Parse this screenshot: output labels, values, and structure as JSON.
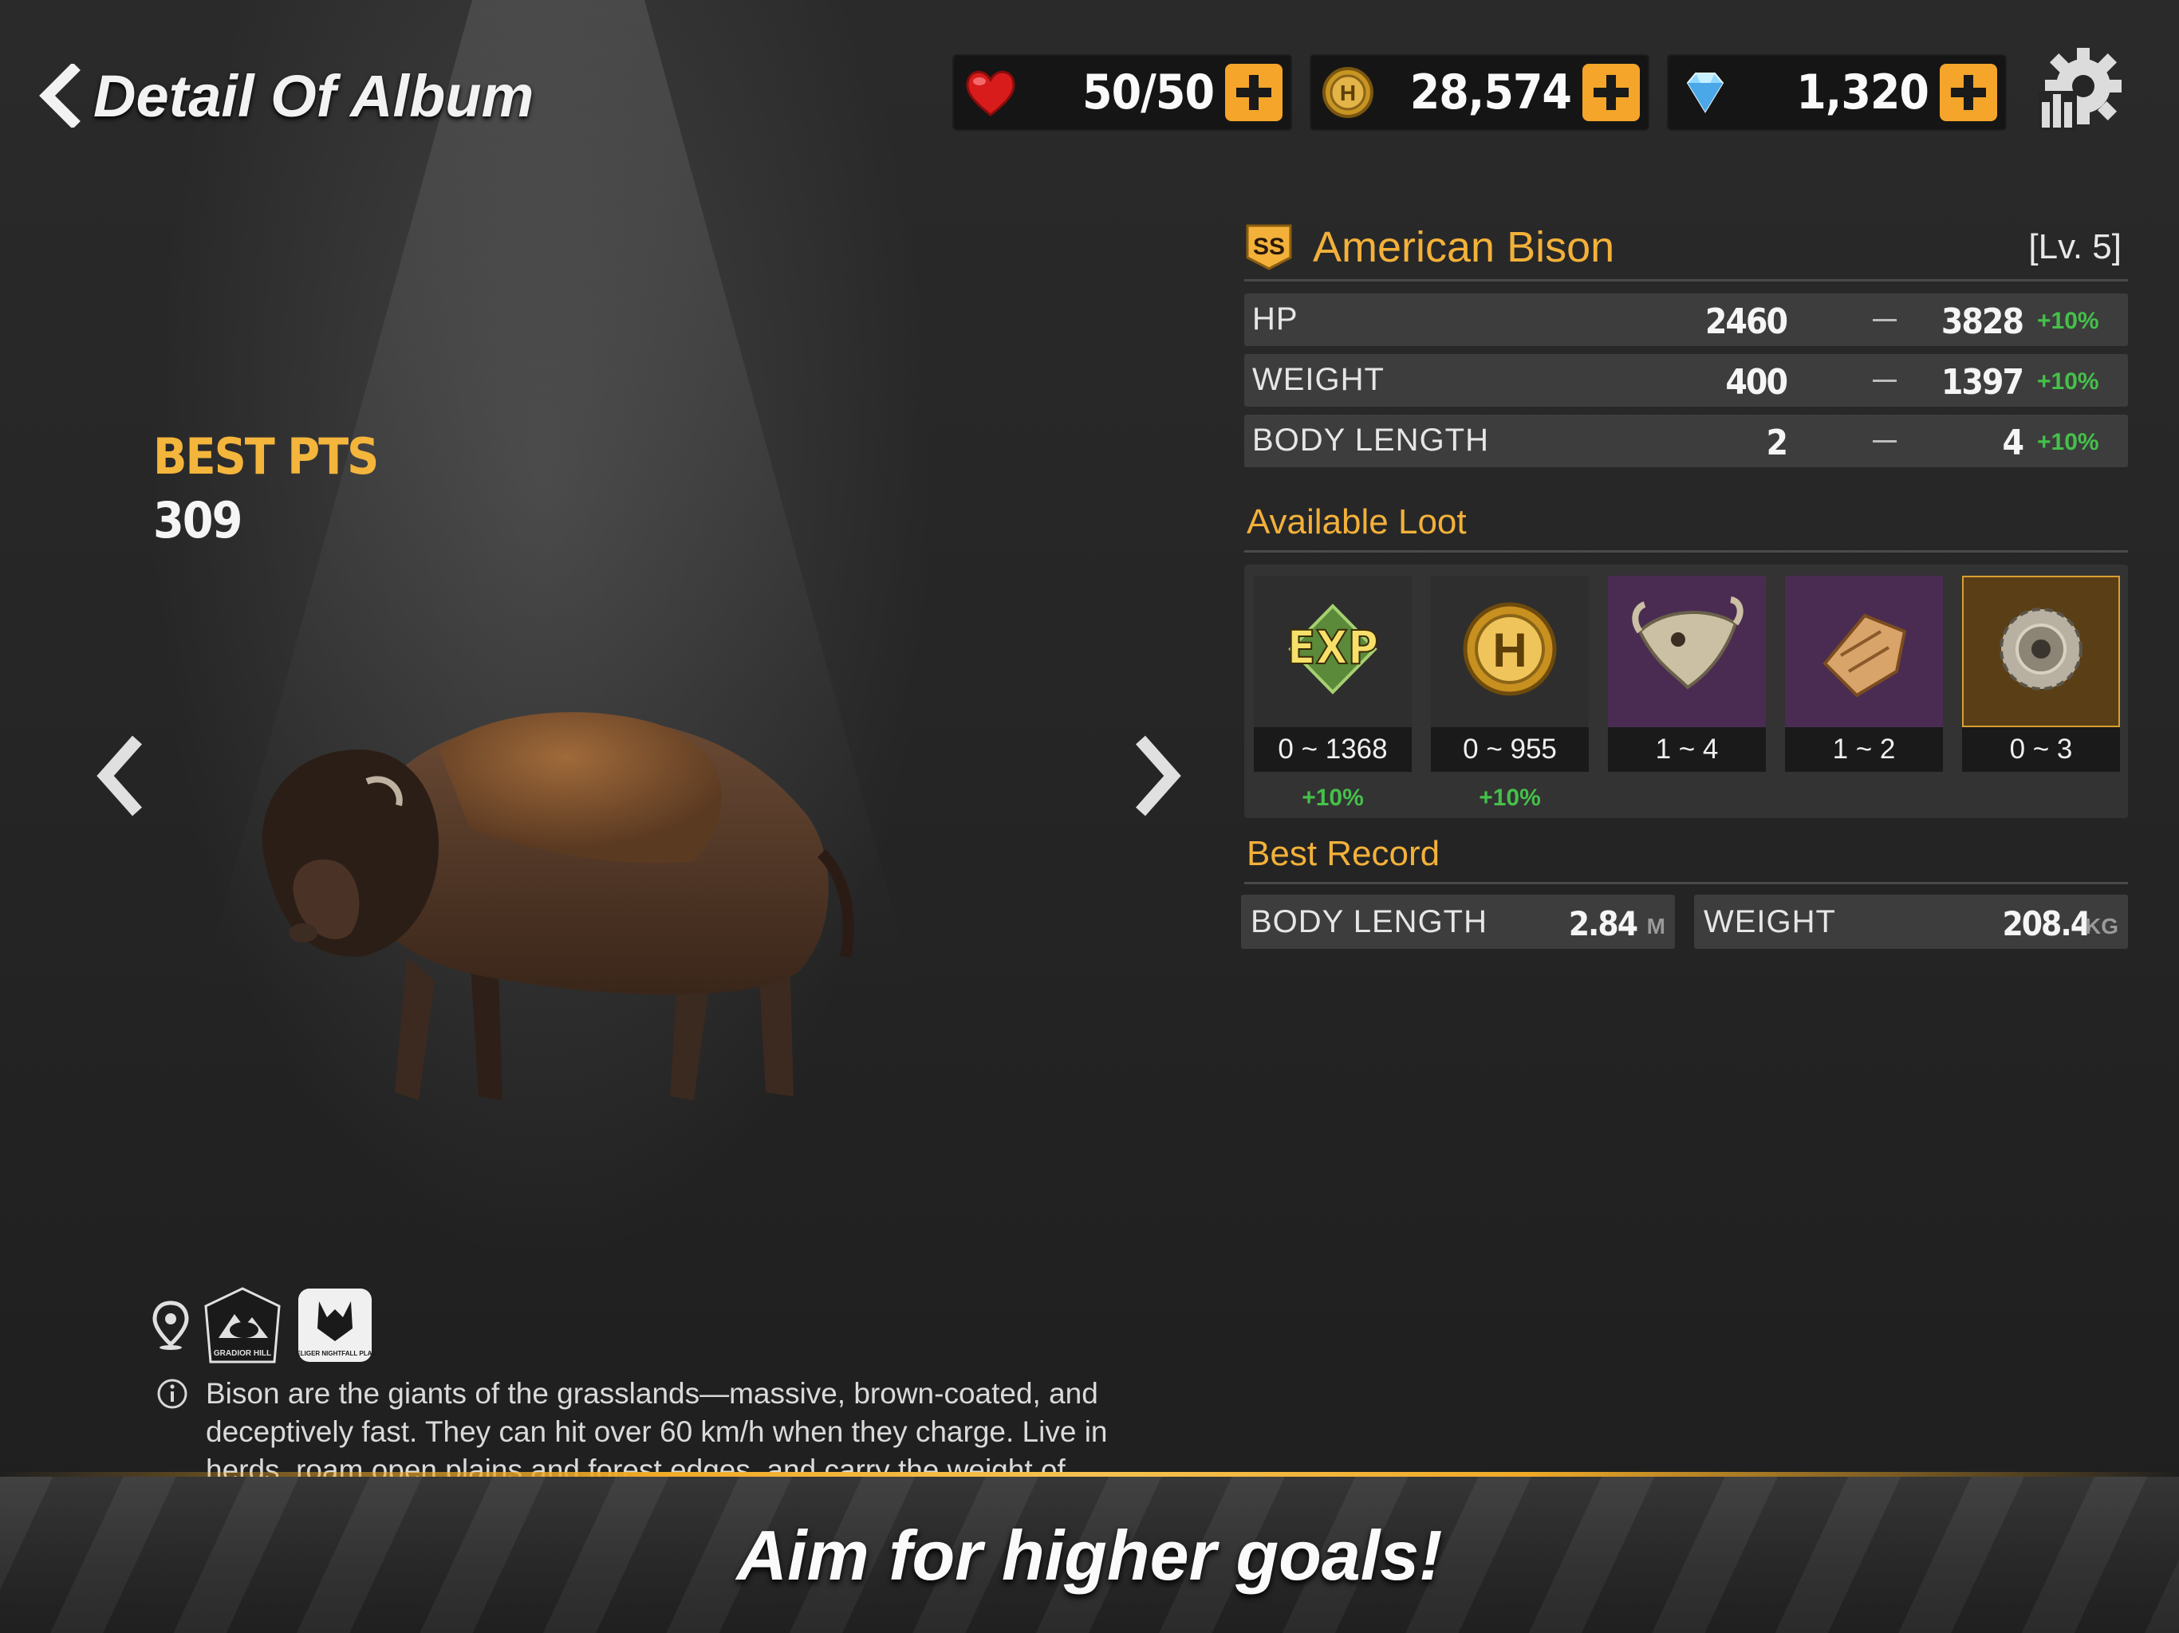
{
  "header": {
    "back_label": "Detail Of Album",
    "resources": {
      "energy": "50/50",
      "coins": "28,574",
      "gems": "1,320"
    }
  },
  "left": {
    "best_pts_label": "BEST PTS",
    "best_pts_value": "309",
    "map_badges": [
      "GRADIOR HILL",
      "BELIGER NIGHTFALL PLAIN"
    ],
    "description": "Bison are the giants of the grasslands—massive, brown-coated, and deceptively fast. They can hit over 60 km/h when they charge. Live in herds, roam open plains and forest edges, and carry the weight of"
  },
  "animal": {
    "rank": "SS",
    "name": "American Bison",
    "level": "[Lv. 5]",
    "stats": [
      {
        "label": "HP",
        "min": "2460",
        "max": "3828",
        "bonus": "+10%"
      },
      {
        "label": "WEIGHT",
        "min": "400",
        "max": "1397",
        "bonus": "+10%"
      },
      {
        "label": "BODY LENGTH",
        "min": "2",
        "max": "4",
        "bonus": "+10%"
      }
    ]
  },
  "loot": {
    "title": "Available Loot",
    "items": [
      {
        "icon": "exp-icon",
        "count": "0 ~ 1368",
        "bonus": "+10%"
      },
      {
        "icon": "coin-icon",
        "count": "0 ~ 955",
        "bonus": "+10%"
      },
      {
        "icon": "skull-icon",
        "count": "1 ~ 4",
        "bonus": ""
      },
      {
        "icon": "hide-icon",
        "count": "1 ~ 2",
        "bonus": ""
      },
      {
        "icon": "gear-part-icon",
        "count": "0 ~ 3",
        "bonus": ""
      }
    ]
  },
  "best_record": {
    "title": "Best Record",
    "body_length_label": "BODY LENGTH",
    "body_length_value": "2.84",
    "body_length_unit": "M",
    "weight_label": "WEIGHT",
    "weight_value": "208.4",
    "weight_unit": "KG"
  },
  "banner": {
    "text": "Aim for higher goals!"
  },
  "colors": {
    "accent": "#f3b13a",
    "bonus": "#45c04a",
    "plus_button": "#f4a52a"
  }
}
